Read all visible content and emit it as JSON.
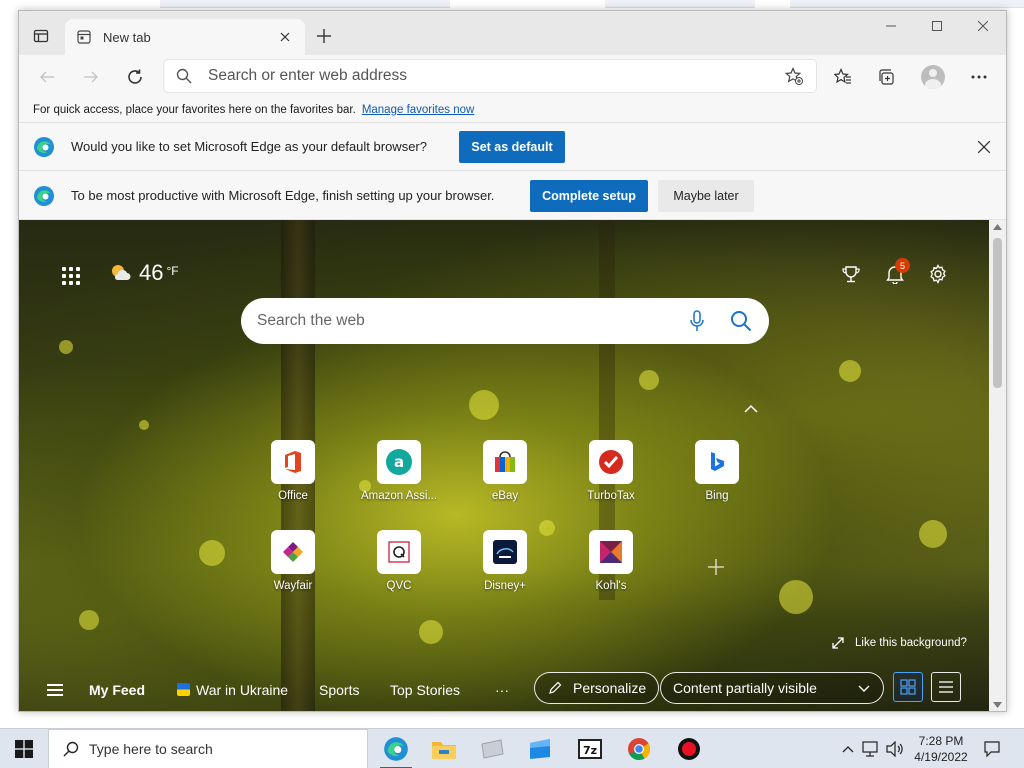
{
  "browser": {
    "tab": {
      "title": "New tab"
    },
    "address_bar": {
      "placeholder": "Search or enter web address"
    },
    "favorites_bar": {
      "message": "For quick access, place your favorites here on the favorites bar.",
      "link": "Manage favorites now"
    },
    "default_prompt": {
      "message": "Would you like to set Microsoft Edge as your default browser?",
      "button": "Set as default"
    },
    "setup_prompt": {
      "message": "To be most productive with Microsoft Edge, finish setting up your browser.",
      "primary_button": "Complete setup",
      "secondary_button": "Maybe later"
    }
  },
  "new_tab_page": {
    "weather": {
      "temperature": "46",
      "unit": "°F",
      "icon": "partly-cloudy-icon"
    },
    "notifications_count": "5",
    "search": {
      "placeholder": "Search the web"
    },
    "quick_links": [
      {
        "label": "Office"
      },
      {
        "label": "Amazon Assi..."
      },
      {
        "label": "eBay"
      },
      {
        "label": "TurboTax"
      },
      {
        "label": "Bing"
      },
      {
        "label": "Wayfair"
      },
      {
        "label": "QVC"
      },
      {
        "label": "Disney+"
      },
      {
        "label": "Kohl's"
      }
    ],
    "background_prompt": "Like this background?",
    "feed": {
      "items": [
        "My Feed",
        "War in Ukraine",
        "Sports",
        "Top Stories"
      ],
      "more": "···",
      "personalize": "Personalize",
      "content_visibility": "Content partially visible"
    }
  },
  "taskbar": {
    "search_placeholder": "Type here to search",
    "time": "7:28 PM",
    "date": "4/19/2022"
  },
  "colors": {
    "accent": "#0f6cbd",
    "link": "#0f5bb5",
    "badge": "#d83b01",
    "taskbar": "#dfe5ee"
  }
}
